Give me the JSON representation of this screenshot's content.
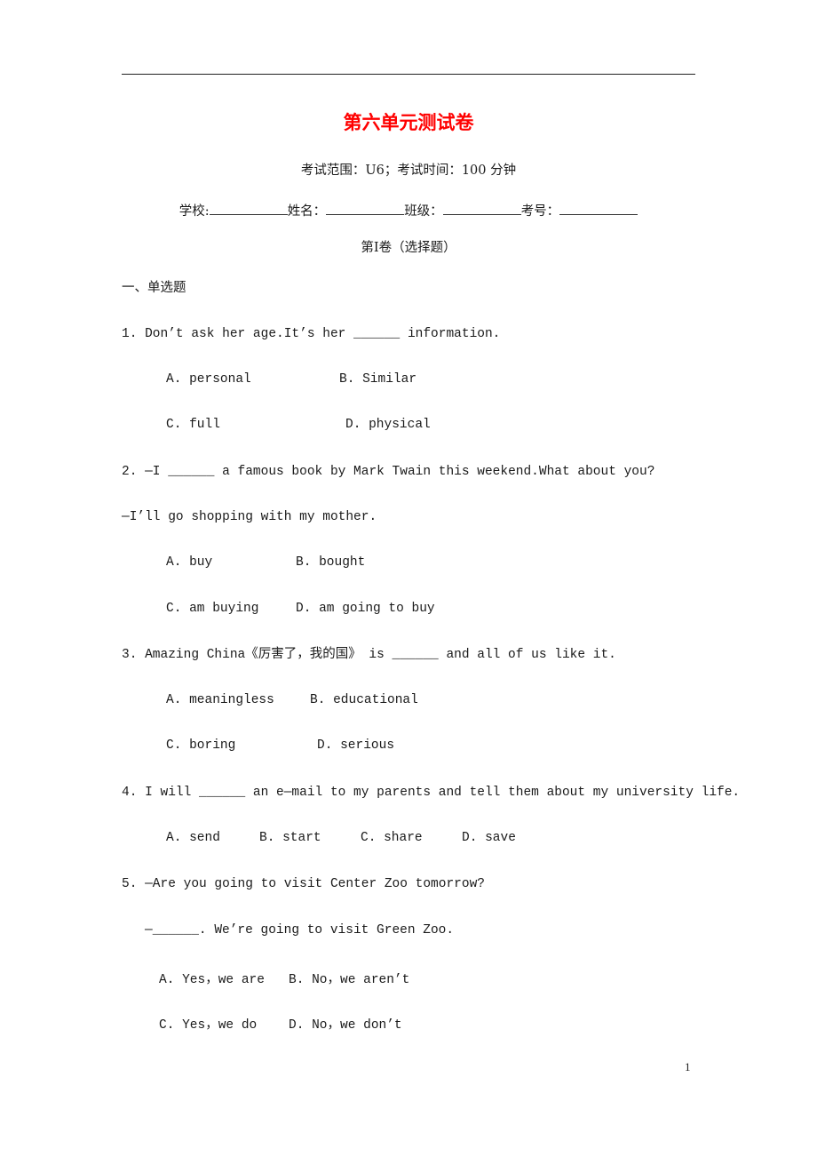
{
  "header": {
    "title": "第六单元测试卷",
    "exam_info": "考试范围：U6；考试时间：100 分钟",
    "fields": [
      {
        "label": "学校:",
        "value": ""
      },
      {
        "label": "姓名：",
        "value": ""
      },
      {
        "label": "班级：",
        "value": ""
      },
      {
        "label": "考号：",
        "value": ""
      }
    ],
    "section_volume": "第I卷（选择题）"
  },
  "section": {
    "heading": "一、单选题"
  },
  "questions": [
    {
      "number": "1.",
      "lines": [
        "Don’t ask her age.It’s her ______ information."
      ],
      "options": [
        "A. personal",
        "B. Similar",
        "C. full",
        "D. physical"
      ]
    },
    {
      "number": "2.",
      "lines": [
        "—I ______ a famous book by Mark Twain this weekend.What about you?",
        "—I’ll go shopping with my mother."
      ],
      "options": [
        "A. buy",
        "B. bought",
        "C. am buying",
        "D. am going to buy"
      ]
    },
    {
      "number": "3.",
      "lines": [
        "Amazing China《厉害了，我的国》 is ______ and all of us like it."
      ],
      "options": [
        "A. meaningless",
        "B. educational",
        "C. boring",
        "D. serious"
      ]
    },
    {
      "number": "4.",
      "lines": [
        "I will ______ an e—mail to my parents and tell them about my university life."
      ],
      "options": [
        "A. send",
        "B. start",
        "C. share",
        "D. save"
      ]
    },
    {
      "number": "5.",
      "lines": [
        "—Are you going to visit Center Zoo tomorrow?",
        "—______. We’re going to visit Green Zoo."
      ],
      "options": [
        "A. Yes，we are",
        "B. No，we aren’t",
        "C. Yes，we do",
        "D. No，we don’t"
      ]
    }
  ],
  "footer": {
    "page_number": "1"
  },
  "colors": {
    "title": "#ff0000",
    "text": "#1a1a1a"
  }
}
